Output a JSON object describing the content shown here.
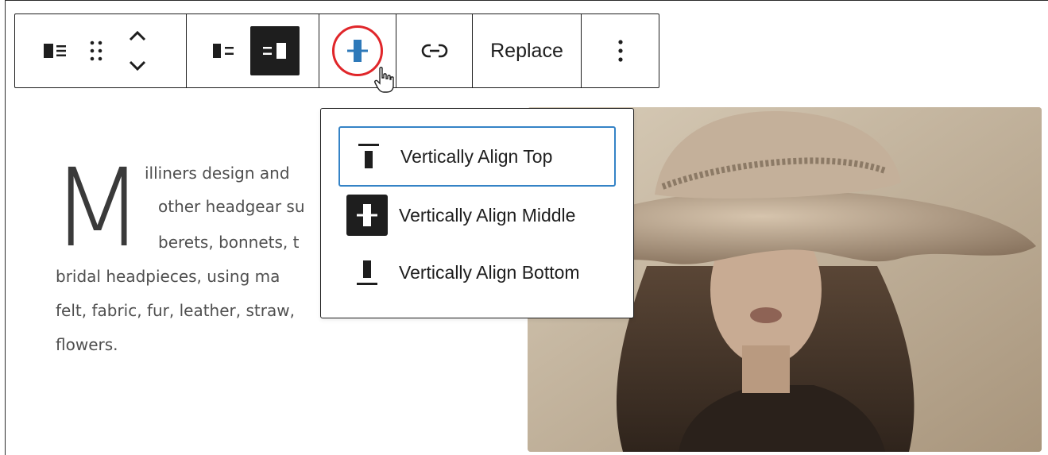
{
  "toolbar": {
    "replace_label": "Replace",
    "accent_color": "#2e79b9",
    "highlight_ring_color": "#e0262a",
    "icons": [
      "block-type-icon",
      "drag-handle-icon",
      "move-up-icon",
      "move-down-icon",
      "media-left-icon",
      "media-right-icon",
      "vertical-align-middle-icon",
      "link-icon",
      "more-options-icon"
    ]
  },
  "menu": {
    "items": [
      {
        "label": "Vertically Align Top",
        "icon": "align-top-icon",
        "focused": true
      },
      {
        "label": "Vertically Align Middle",
        "icon": "align-middle-icon",
        "active": true
      },
      {
        "label": "Vertically Align Bottom",
        "icon": "align-bottom-icon"
      }
    ],
    "focus_color": "#3583c6"
  },
  "content": {
    "dropcap": "M",
    "lines": [
      "illiners design and",
      "other headgear su",
      "berets, bonnets, t",
      "bridal headpieces, using ma",
      "felt, fabric, fur, leather, straw,",
      "flowers."
    ]
  }
}
